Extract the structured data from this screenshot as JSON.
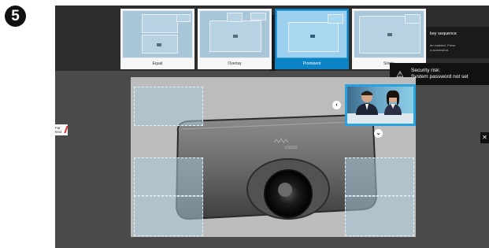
{
  "step_badge": "5",
  "layouts": [
    {
      "label": "Equal",
      "active": false
    },
    {
      "label": "Overlay",
      "active": false
    },
    {
      "label": "Prominent",
      "active": true
    },
    {
      "label": "Single",
      "active": false
    }
  ],
  "notification": {
    "title": "key sequence",
    "detail_line1": "de enabled. Press",
    "detail_line2": "a screenshot."
  },
  "security_alert": {
    "line1": "Security risk:",
    "line2": "System password not set"
  },
  "far_end": {
    "line1": "Far",
    "line2": "End"
  },
  "device_logo": "cisco",
  "icons": {
    "warning": "warning-icon",
    "mute": "mic-muted-icon",
    "back": "chevron-left-icon",
    "down": "chevron-down-icon"
  },
  "colors": {
    "accent": "#0d84c6",
    "selected_thumb": "#9cd0ee",
    "slot": "#a6c8db",
    "pip_border": "#2aa2e0"
  }
}
